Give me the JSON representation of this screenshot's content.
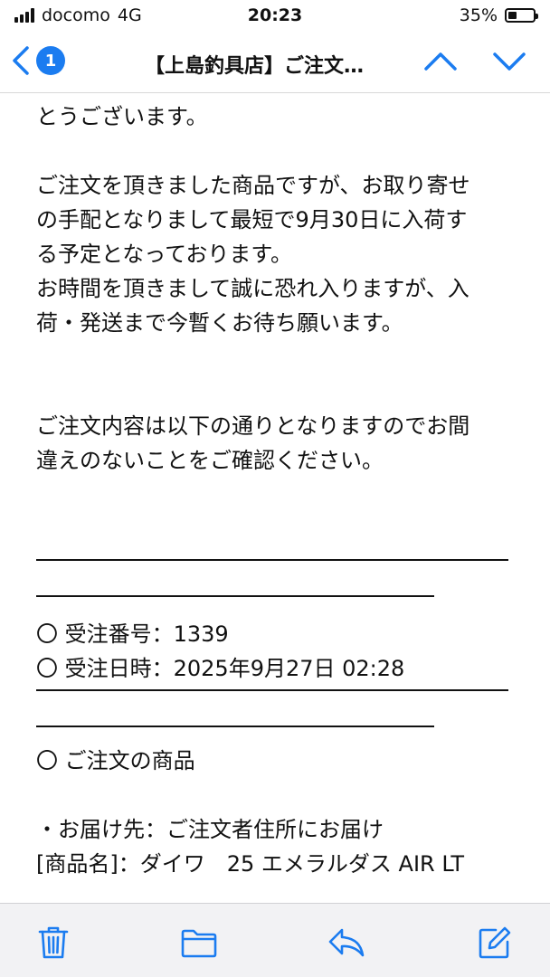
{
  "status_bar": {
    "carrier": "docomo",
    "network": "4G",
    "time": "20:23",
    "battery_percent": "35%",
    "battery_level": 0.35
  },
  "nav": {
    "unread_count": "1",
    "title": "【上島釣具店】ご注文…",
    "accent_color": "#1b7cf0"
  },
  "body": {
    "line_1": "とうございます。",
    "para_2_line_1": "ご注文を頂きました商品ですが、お取り寄せ",
    "para_2_line_2": "の手配となりまして最短で9月30日に入荷す",
    "para_2_line_3": "る予定となっております。",
    "para_2_line_4": "お時間を頂きまして誠に恐れ入りますが、入",
    "para_2_line_5": "荷・発送まで今暫くお待ち願います。",
    "para_3_line_1": "ご注文内容は以下の通りとなりますのでお間",
    "para_3_line_2": "違えのないことをご確認ください。",
    "order_number": "〇 受注番号：1339",
    "order_datetime": "〇 受注日時：2025年9月27日 02:28",
    "items_heading": "〇 ご注文の商品",
    "delivery": "・お届け先：ご注文者住所にお届け",
    "product_name": "[商品名]：ダイワ　25 エメラルダス AIR LT"
  },
  "toolbar": {
    "icons": [
      "trash-icon",
      "folder-icon",
      "reply-icon",
      "compose-icon"
    ],
    "icon_color": "#1b7cf0"
  }
}
